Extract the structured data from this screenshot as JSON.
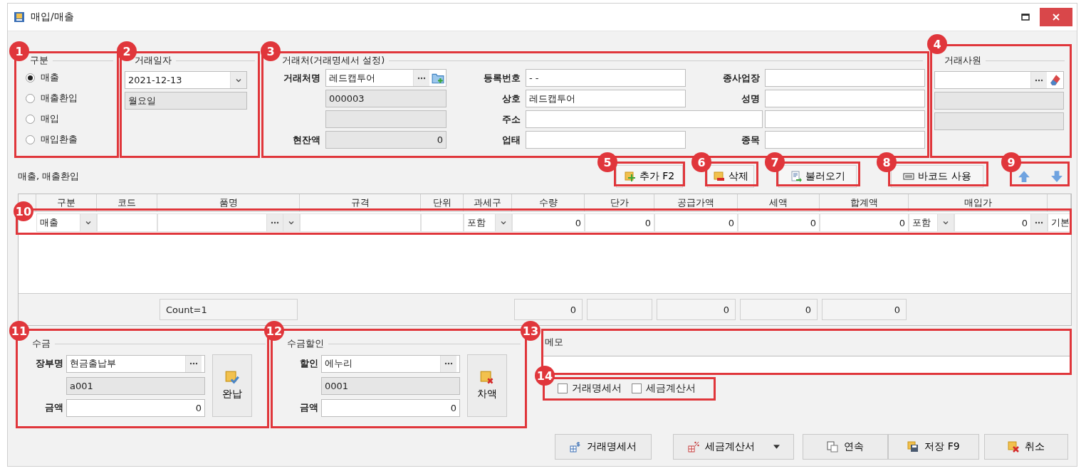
{
  "window": {
    "title": "매입/매출"
  },
  "type_group": {
    "title": "구분",
    "options": [
      {
        "label": "매출",
        "selected": true
      },
      {
        "label": "매출환입",
        "selected": false
      },
      {
        "label": "매입",
        "selected": false
      },
      {
        "label": "매입환출",
        "selected": false
      }
    ]
  },
  "date_group": {
    "title": "거래일자",
    "date": "2021-12-13",
    "weekday": "월요일"
  },
  "partner_group": {
    "title": "거래처(거래명세서 설정)",
    "name_label": "거래처명",
    "name": "레드캡투어",
    "code": "000003",
    "balance_label": "현잔액",
    "balance": "0",
    "reg_label": "등록번호",
    "reg_no": "- -",
    "company_label": "상호",
    "company": "레드캡투어",
    "address_label": "주소",
    "business_label": "업태",
    "workplace_label": "종사업장",
    "person_label": "성명",
    "item_label": "종목"
  },
  "staff_group": {
    "title": "거래사원"
  },
  "toolbar": {
    "caption": "매출, 매출환입",
    "buttons": [
      {
        "label": "추가 F2",
        "kind": "add"
      },
      {
        "label": "삭제",
        "kind": "delete"
      },
      {
        "label": "불러오기",
        "kind": "import"
      },
      {
        "label": "바코드 사용",
        "kind": "barcode"
      }
    ]
  },
  "grid": {
    "columns": [
      "",
      "구분",
      "코드",
      "품명",
      "규격",
      "단위",
      "과세구",
      "수량",
      "단가",
      "공급가액",
      "세액",
      "합계액",
      "매입가",
      ""
    ],
    "rows": [
      {
        "cells": [
          {
            "kind": "row_header"
          },
          {
            "kind": "combo",
            "value": "매출"
          },
          {
            "kind": "text"
          },
          {
            "kind": "lookup_combo"
          },
          {
            "kind": "text"
          },
          {
            "kind": "text"
          },
          {
            "kind": "combo",
            "value": "포함"
          },
          {
            "kind": "number",
            "value": "0"
          },
          {
            "kind": "number",
            "value": "0"
          },
          {
            "kind": "number",
            "value": "0"
          },
          {
            "kind": "number",
            "value": "0"
          },
          {
            "kind": "number",
            "value": "0"
          },
          {
            "kind": "combo_lookup",
            "value": "포함",
            "amount": "0"
          },
          {
            "kind": "text",
            "value": "기본"
          }
        ]
      }
    ],
    "footer": [
      {
        "kind": "none"
      },
      {
        "kind": "none"
      },
      {
        "kind": "none"
      },
      {
        "kind": "label",
        "value": "Count=1"
      },
      {
        "kind": "none"
      },
      {
        "kind": "none"
      },
      {
        "kind": "none"
      },
      {
        "kind": "total",
        "value": "0"
      },
      {
        "kind": "total"
      },
      {
        "kind": "total",
        "value": "0"
      },
      {
        "kind": "total",
        "value": "0"
      },
      {
        "kind": "total",
        "value": "0"
      },
      {
        "kind": "none"
      },
      {
        "kind": "none"
      }
    ]
  },
  "receipt_group": {
    "title": "수금",
    "ledger_label": "장부명",
    "ledger": "현금출납부",
    "code": "a001",
    "amount_label": "금액",
    "amount": "0",
    "button": "완납"
  },
  "discount_group": {
    "title": "수금할인",
    "ledger_label": "할인",
    "ledger": "에누리",
    "code": "0001",
    "amount_label": "금액",
    "amount": "0",
    "button": "차액"
  },
  "memo": {
    "title": "메모"
  },
  "print_options": [
    {
      "label": "거래명세서",
      "checked": false
    },
    {
      "label": "세금계산서",
      "checked": false
    }
  ],
  "actions": [
    {
      "label": "거래명세서",
      "kind": "statement",
      "dropdown": false
    },
    {
      "label": "세금계산서",
      "kind": "tax_invoice",
      "dropdown": true
    },
    {
      "label": "연속",
      "kind": "continue",
      "dropdown": false
    },
    {
      "label": "저장 F9",
      "kind": "save",
      "dropdown": false
    },
    {
      "label": "취소",
      "kind": "cancel",
      "dropdown": false
    }
  ],
  "annotations": [
    "1",
    "2",
    "3",
    "4",
    "5",
    "6",
    "7",
    "8",
    "9",
    "10",
    "11",
    "12",
    "13",
    "14"
  ]
}
